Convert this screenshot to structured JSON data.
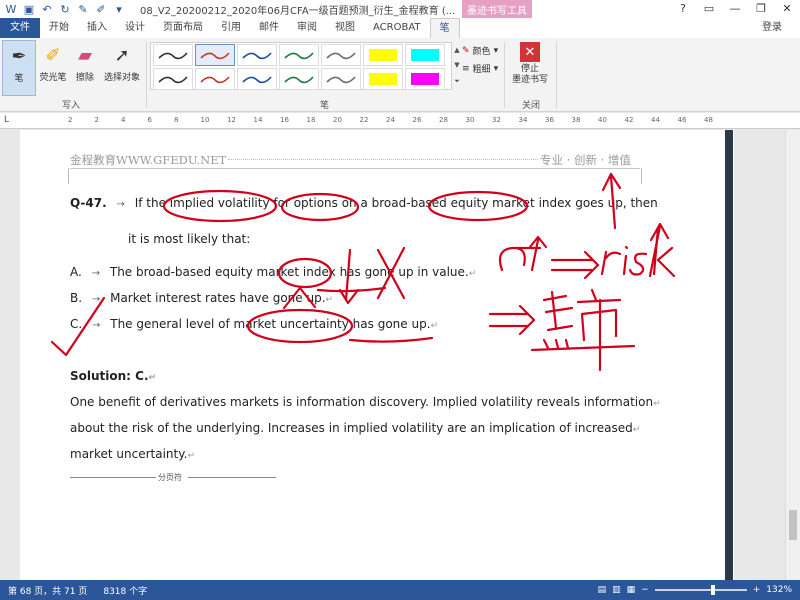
{
  "titlebar": {
    "doc_title": "08_V2_20200212_2020年06月CFA一级百题预测_衍生_金程教育 (...",
    "tool_tab": "墨迹书写工具",
    "login": "登录"
  },
  "tabs": [
    "开始",
    "插入",
    "设计",
    "页面布局",
    "引用",
    "邮件",
    "审阅",
    "视图",
    "ACROBAT",
    "笔"
  ],
  "file_tab": "文件",
  "ribbon": {
    "pen_label": "笔",
    "highlighter_label": "荧光笔",
    "eraser_label": "擦除",
    "select_label": "选择对象",
    "write_group": "写入",
    "pens_group": "笔",
    "color_label": "颜色",
    "thickness_label": "粗细",
    "stop_label": "停止\n墨迹书写",
    "close_group": "关闭",
    "pen_colors": [
      "#333333",
      "#c0392b",
      "#1f4e9c",
      "#1e7a3c",
      "#6b6b6b",
      "#ffff00",
      "#00ffff",
      "#333333",
      "#c0392b",
      "#1f4e9c",
      "#1e7a3c",
      "#6b6b6b",
      "#ffff00",
      "#ff00ff"
    ]
  },
  "ruler_ticks": [
    "2",
    "2",
    "4",
    "6",
    "8",
    "10",
    "12",
    "14",
    "16",
    "18",
    "20",
    "22",
    "24",
    "26",
    "28",
    "30",
    "32",
    "34",
    "36",
    "38",
    "40",
    "42",
    "44",
    "46",
    "48"
  ],
  "page": {
    "header_left": "金程教育WWW.GFEDU.NET",
    "header_right": "专业 · 创新 · 增值",
    "q_num": "Q-47.",
    "q_line1": "If the implied volatility for options on a broad-based equity market index goes up, then",
    "q_line2": "it is most likely that:",
    "opt_a_label": "A.",
    "opt_a": "The broad-based equity market index has gone up in value.",
    "opt_b_label": "B.",
    "opt_b": "Market interest rates have gone up.",
    "opt_c_label": "C.",
    "opt_c": "The general level of market uncertainty has gone up.",
    "solution": "Solution: C.",
    "sol_line1": "One benefit of derivatives markets is information discovery. Implied volatility reveals information",
    "sol_line2": "about the risk of the underlying. Increases in implied volatility are an implication of increased",
    "sol_line3": "market uncertainty.",
    "page_break": "分页符"
  },
  "ink": {
    "color": "#d0021b",
    "note_risk": "σ↑ ⇒ risk↑",
    "note_bear": "⇒ 熊市"
  },
  "status": {
    "page": "第 68 页，共 71 页",
    "words": "8318 个字",
    "zoom": "132%"
  }
}
